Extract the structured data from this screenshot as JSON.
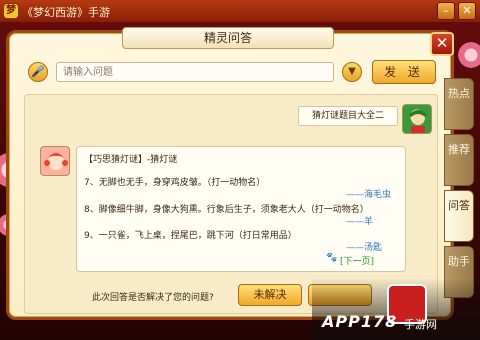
{
  "app": {
    "logo_glyph": "梦",
    "title": "《梦幻西游》手游"
  },
  "window": {
    "minimize": "–",
    "close": "✕",
    "panel_close": "✕"
  },
  "panel": {
    "title": "精灵问答"
  },
  "search": {
    "placeholder": "请输入问题",
    "value": "",
    "send_label": "发 送"
  },
  "tabs": [
    {
      "label": "热点",
      "active": false
    },
    {
      "label": "推荐",
      "active": false
    },
    {
      "label": "问答",
      "active": true
    },
    {
      "label": "助手",
      "active": false
    }
  ],
  "chat": {
    "user_message": "猜灯谜题目大全二",
    "answer": {
      "heading": "【巧思猜灯谜】-猜灯谜",
      "riddles": [
        {
          "text": "7、无脚也无手，身穿鸡皮皱。（打一动物名）",
          "answer": "——海毛虫"
        },
        {
          "text": "8、脚像细牛脚，身像大狗熏。行象后生子，须象老大人（打一动物名）",
          "answer": "——羊"
        },
        {
          "text": "9、一只雀，飞上桌，捏尾巴，跳下河（打日常用品）",
          "answer": "——汤匙"
        }
      ],
      "next_link": "[下一页]"
    },
    "footer_question": "此次回答是否解决了您的问题?",
    "unsolved_label": "未解决"
  },
  "watermark": {
    "brand": "APP178",
    "suffix": "手游网"
  },
  "colors": {
    "accent": "#f0a82a",
    "answer_link": "#2a7ac8",
    "next_link": "#2a9a2a",
    "frame": "#9a4a16"
  }
}
